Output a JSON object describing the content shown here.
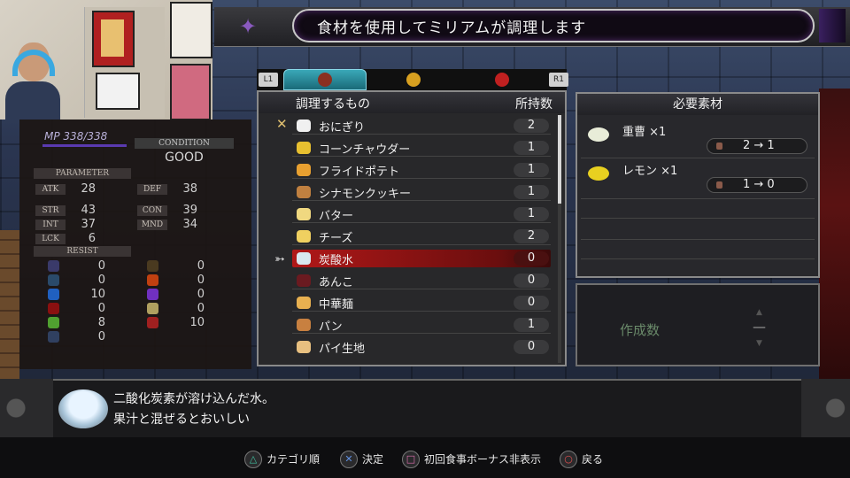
{
  "title": "食材を使用してミリアムが調理します",
  "status": {
    "mp_label": "MP",
    "mp_value": "338/338",
    "condition_label": "CONDITION",
    "condition_value": "GOOD",
    "parameter_label": "PARAMETER",
    "params": [
      {
        "k": "ATK",
        "v": "28"
      },
      {
        "k": "DEF",
        "v": "38"
      },
      {
        "k": "STR",
        "v": "43"
      },
      {
        "k": "CON",
        "v": "39"
      },
      {
        "k": "INT",
        "v": "37"
      },
      {
        "k": "MND",
        "v": "34"
      },
      {
        "k": "LCK",
        "v": "6"
      }
    ],
    "resist_label": "RESIST",
    "resists": [
      {
        "icon": "slash-icon",
        "v": "0",
        "color": "#3a3a6a"
      },
      {
        "icon": "strike-icon",
        "v": "0",
        "color": "#4a3a20"
      },
      {
        "icon": "pierce-icon",
        "v": "0",
        "color": "#2a4a6a"
      },
      {
        "icon": "fire-icon",
        "v": "0",
        "color": "#c04010"
      },
      {
        "icon": "ice-icon",
        "v": "10",
        "color": "#2060c0"
      },
      {
        "icon": "lightning-icon",
        "v": "0",
        "color": "#7030c0"
      },
      {
        "icon": "petrify-icon",
        "v": "0",
        "color": "#8a1010"
      },
      {
        "icon": "light-icon",
        "v": "0",
        "color": "#b0a060"
      },
      {
        "icon": "poison-icon",
        "v": "8",
        "color": "#50a030"
      },
      {
        "icon": "curse-icon",
        "v": "10",
        "color": "#a02020"
      },
      {
        "icon": "dark-icon",
        "v": "0",
        "color": "#304060"
      }
    ]
  },
  "tabs": {
    "l1": "L1",
    "r1": "R1"
  },
  "list": {
    "header_name": "調理するもの",
    "header_qty": "所持数",
    "items": [
      {
        "name": "おにぎり",
        "qty": "2",
        "color": "#f0f0f0"
      },
      {
        "name": "コーンチャウダー",
        "qty": "1",
        "color": "#e8c030"
      },
      {
        "name": "フライドポテト",
        "qty": "1",
        "color": "#e8a030"
      },
      {
        "name": "シナモンクッキー",
        "qty": "1",
        "color": "#c08040"
      },
      {
        "name": "バター",
        "qty": "1",
        "color": "#f0d880"
      },
      {
        "name": "チーズ",
        "qty": "2",
        "color": "#f0d060"
      },
      {
        "name": "炭酸水",
        "qty": "0",
        "color": "#d8e8f0"
      },
      {
        "name": "あんこ",
        "qty": "0",
        "color": "#6a1a20"
      },
      {
        "name": "中華麺",
        "qty": "0",
        "color": "#e8b050"
      },
      {
        "name": "パン",
        "qty": "1",
        "color": "#c88040"
      },
      {
        "name": "パイ生地",
        "qty": "0",
        "color": "#e8c080"
      }
    ]
  },
  "materials": {
    "header": "必要素材",
    "items": [
      {
        "name": "重曹 ×1",
        "count": "2 → 1",
        "color": "#e8ecd8"
      },
      {
        "name": "レモン ×1",
        "count": "1 → 0",
        "color": "#e8d020"
      }
    ]
  },
  "craft": {
    "label": "作成数",
    "value": "—"
  },
  "description": {
    "line1": "二酸化炭素が溶け込んだ水。",
    "line2": "果汁と混ぜるとおいしい"
  },
  "hints": [
    {
      "btn": "△",
      "label": "カテゴリ順",
      "color": "#40c0a0"
    },
    {
      "btn": "✕",
      "label": "決定",
      "color": "#6090e0"
    },
    {
      "btn": "□",
      "label": "初回食事ボーナス非表示",
      "color": "#e070b0"
    },
    {
      "btn": "○",
      "label": "戻る",
      "color": "#e05050"
    }
  ]
}
